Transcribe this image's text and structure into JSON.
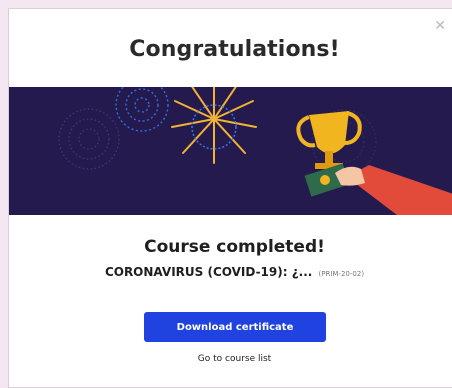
{
  "modal": {
    "close_icon": "close-icon",
    "title": "Congratulations!",
    "banner_illustration": "fireworks-trophy-illustration",
    "completed_text": "Course completed!",
    "course_title": "CORONAVIRUS (COVID-19): ¿...",
    "course_code": "(PRIM-20-02)",
    "download_label": "Download certificate",
    "go_to_list_label": "Go to course list",
    "colors": {
      "banner_bg": "#241a4e",
      "primary_button": "#1f42e0",
      "trophy": "#f0b51f",
      "firework_blue": "#2f6fe6",
      "firework_gold": "#f2b233"
    }
  }
}
